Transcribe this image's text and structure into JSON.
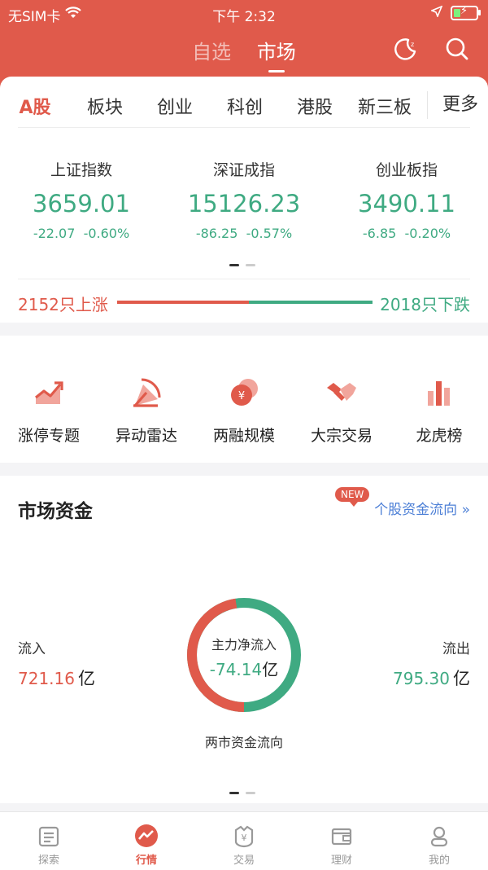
{
  "status": {
    "carrier": "无SIM卡",
    "time": "下午 2:32"
  },
  "nav": {
    "tabs": [
      {
        "label": "自选"
      },
      {
        "label": "市场"
      }
    ]
  },
  "market_tabs": [
    {
      "label": "A股"
    },
    {
      "label": "板块"
    },
    {
      "label": "创业"
    },
    {
      "label": "科创"
    },
    {
      "label": "港股"
    },
    {
      "label": "新三板"
    }
  ],
  "more_label": "更多",
  "indices": [
    {
      "name": "上证指数",
      "value": "3659.01",
      "change": "-22.07",
      "pct": "-0.60%"
    },
    {
      "name": "深证成指",
      "value": "15126.23",
      "change": "-86.25",
      "pct": "-0.57%"
    },
    {
      "name": "创业板指",
      "value": "3490.11",
      "change": "-6.85",
      "pct": "-0.20%"
    }
  ],
  "breadth": {
    "up_label": "2152只上涨",
    "down_label": "2018只下跌",
    "up": 2152,
    "down": 2018
  },
  "tools": [
    {
      "label": "涨停专题",
      "icon": "trend-up-icon"
    },
    {
      "label": "异动雷达",
      "icon": "radar-icon"
    },
    {
      "label": "两融规模",
      "icon": "coin-icon"
    },
    {
      "label": "大宗交易",
      "icon": "handshake-icon"
    },
    {
      "label": "龙虎榜",
      "icon": "bar-chart-icon"
    }
  ],
  "fund": {
    "title": "市场资金",
    "badge": "NEW",
    "link": "个股资金流向",
    "link_arrow": "»",
    "inflow_label": "流入",
    "inflow_value": "721.16",
    "outflow_label": "流出",
    "outflow_value": "795.30",
    "unit": "亿",
    "net_label": "主力净流入",
    "net_value": "-74.14",
    "caption": "两市资金流向",
    "inflow_share": 0.4756
  },
  "tabbar": [
    {
      "label": "探索",
      "icon": "explore-icon"
    },
    {
      "label": "行情",
      "icon": "market-icon"
    },
    {
      "label": "交易",
      "icon": "trade-icon"
    },
    {
      "label": "理财",
      "icon": "wallet-icon"
    },
    {
      "label": "我的",
      "icon": "profile-icon"
    }
  ],
  "colors": {
    "brand": "#e05a4b",
    "up": "#e05a4b",
    "down": "#3faa82",
    "link": "#4c7fd6"
  }
}
